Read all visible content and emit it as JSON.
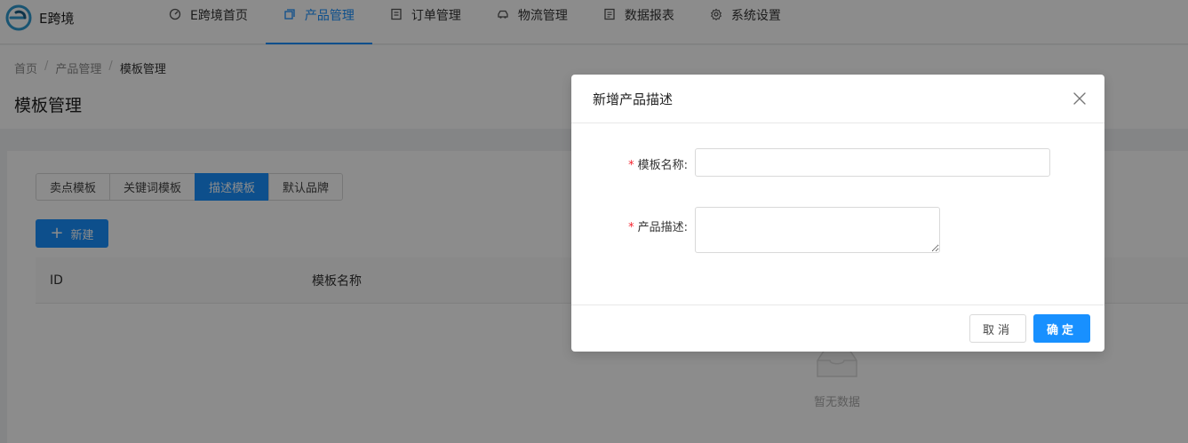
{
  "header": {
    "logo_text": "E跨境",
    "nav": [
      {
        "label": "E跨境首页",
        "icon": "dashboard-icon",
        "active": false
      },
      {
        "label": "产品管理",
        "icon": "copy-icon",
        "active": true
      },
      {
        "label": "订单管理",
        "icon": "order-list-icon",
        "active": false
      },
      {
        "label": "物流管理",
        "icon": "car-icon",
        "active": false
      },
      {
        "label": "数据报表",
        "icon": "report-icon",
        "active": false
      },
      {
        "label": "系统设置",
        "icon": "gear-icon",
        "active": false
      }
    ]
  },
  "breadcrumb": {
    "items": [
      "首页",
      "产品管理",
      "模板管理"
    ],
    "separator": "/"
  },
  "page": {
    "title": "模板管理"
  },
  "tabs": [
    {
      "label": "卖点模板",
      "active": false
    },
    {
      "label": "关键词模板",
      "active": false
    },
    {
      "label": "描述模板",
      "active": true
    },
    {
      "label": "默认品牌",
      "active": false
    }
  ],
  "toolbar": {
    "new_label": "新建"
  },
  "table": {
    "columns": [
      "ID",
      "模板名称"
    ],
    "empty_text": "暂无数据"
  },
  "modal": {
    "title": "新增产品描述",
    "fields": {
      "name_label": "模板名称:",
      "name_value": "",
      "desc_label": "产品描述:",
      "desc_value": ""
    },
    "required_mark": "*",
    "cancel_label": "取消",
    "ok_label": "确定"
  },
  "colors": {
    "primary": "#1890ff",
    "required": "#f5222d",
    "mask": "rgba(0,0,0,0.45)"
  }
}
